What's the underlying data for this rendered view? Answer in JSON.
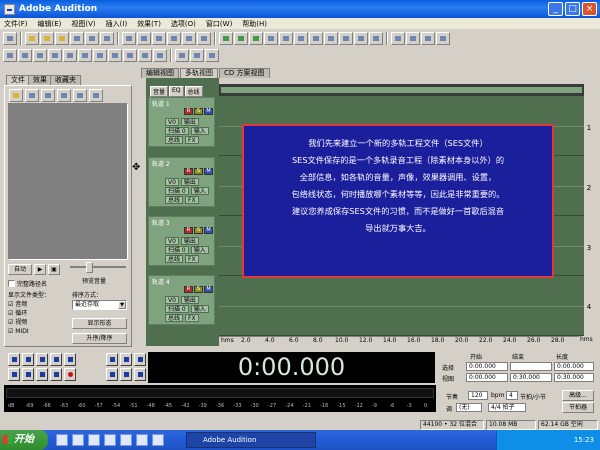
{
  "window": {
    "title": "Adobe Audition"
  },
  "menu": [
    "文件(F)",
    "编辑(E)",
    "视图(V)",
    "插入(I)",
    "效果(T)",
    "选项(O)",
    "窗口(W)",
    "帮助(H)"
  ],
  "left_tabs": [
    "文件",
    "效果",
    "收藏夹"
  ],
  "view_tabs": [
    "编辑视图",
    "多轨视图",
    "CD 方案视图"
  ],
  "left_panel": {
    "import_btn": "自动",
    "preview_btn": "",
    "dock_btn": "",
    "volume_label": "预览音量",
    "auto_play_label": "自动播放",
    "full_path_label": "完整路径名",
    "show_type_label": "显示文件类型：",
    "sort_label": "排序方式：",
    "sort_value": "最近存取",
    "options": [
      "音频",
      "循环",
      "视频",
      "MIDI"
    ],
    "sort_btn1": "显示形态",
    "sort_btn2": "升序/降序"
  },
  "track_header": {
    "tabs": [
      "音量",
      "EQ",
      "总线"
    ]
  },
  "tracks": [
    {
      "name": "轨道 1",
      "vol": "V0",
      "pan": "扫描 0",
      "out": "输出",
      "in": "输入",
      "fx": "FX",
      "bus": "总线"
    },
    {
      "name": "轨道 2",
      "vol": "V0",
      "pan": "扫描 0",
      "out": "输出",
      "in": "输入",
      "fx": "FX",
      "bus": "总线"
    },
    {
      "name": "轨道 3",
      "vol": "V0",
      "pan": "扫描 0",
      "out": "输出",
      "in": "输入",
      "fx": "FX",
      "bus": "总线"
    },
    {
      "name": "轨道 4",
      "vol": "V0",
      "pan": "扫描 0",
      "out": "输出",
      "in": "输入",
      "fx": "FX",
      "bus": "总线"
    }
  ],
  "overlay": {
    "lines": [
      "我们先来建立一个新的多轨工程文件（SES文件）",
      "SES文件保存的是一个多轨录音工程（除素材本身以外）的",
      "全部信息，如各轨的音量，声像，效果器调用、设置，",
      "包络线状态，何时播放哪个素材等等，因此是非常重要的。",
      "建议您养成保存SES文件的习惯，而不是做好一首歌后混音",
      "导出就万事大吉。"
    ]
  },
  "ruler": {
    "unit": "hms",
    "ticks": [
      "hms",
      "2.0",
      "4.0",
      "6.0",
      "8.0",
      "10.0",
      "12.0",
      "14.0",
      "16.0",
      "18.0",
      "20.0",
      "22.0",
      "24.0",
      "26.0",
      "28.0"
    ]
  },
  "right_numbers": [
    "1",
    "2",
    "3",
    "4"
  ],
  "clock": "0:00.000",
  "level_ticks": [
    "dB",
    "-69",
    "-66",
    "-63",
    "-60",
    "-57",
    "-54",
    "-51",
    "-48",
    "-45",
    "-42",
    "-39",
    "-36",
    "-33",
    "-30",
    "-27",
    "-24",
    "-21",
    "-18",
    "-15",
    "-12",
    "-9",
    "-6",
    "-3",
    "0"
  ],
  "selection": {
    "headers": [
      "开始",
      "结束",
      "长度"
    ],
    "row_labels": [
      "选择",
      "视图"
    ],
    "sel_start": "0:00.000",
    "sel_end": "",
    "sel_len": "0:00.000",
    "view_start": "0:00.000",
    "view_end": "0:30.000",
    "view_len": "0:30.000"
  },
  "bpm": {
    "tempo_label": "节奏",
    "tempo": "120",
    "bpm_label": "bpm",
    "beats": "4",
    "beats_label": "节拍/小节",
    "key_label": "调",
    "key": "(无)",
    "time_sig": "4/4 拍子",
    "adv_btn": "高级...",
    "metro_btn": "节拍器"
  },
  "status": {
    "format": "44100 • 32 位混合",
    "size": "10.08 MB",
    "disk": "62.14 GB 空闲"
  },
  "taskbar": {
    "start": "开始",
    "task": "Adobe Audition",
    "time": "15:23"
  }
}
